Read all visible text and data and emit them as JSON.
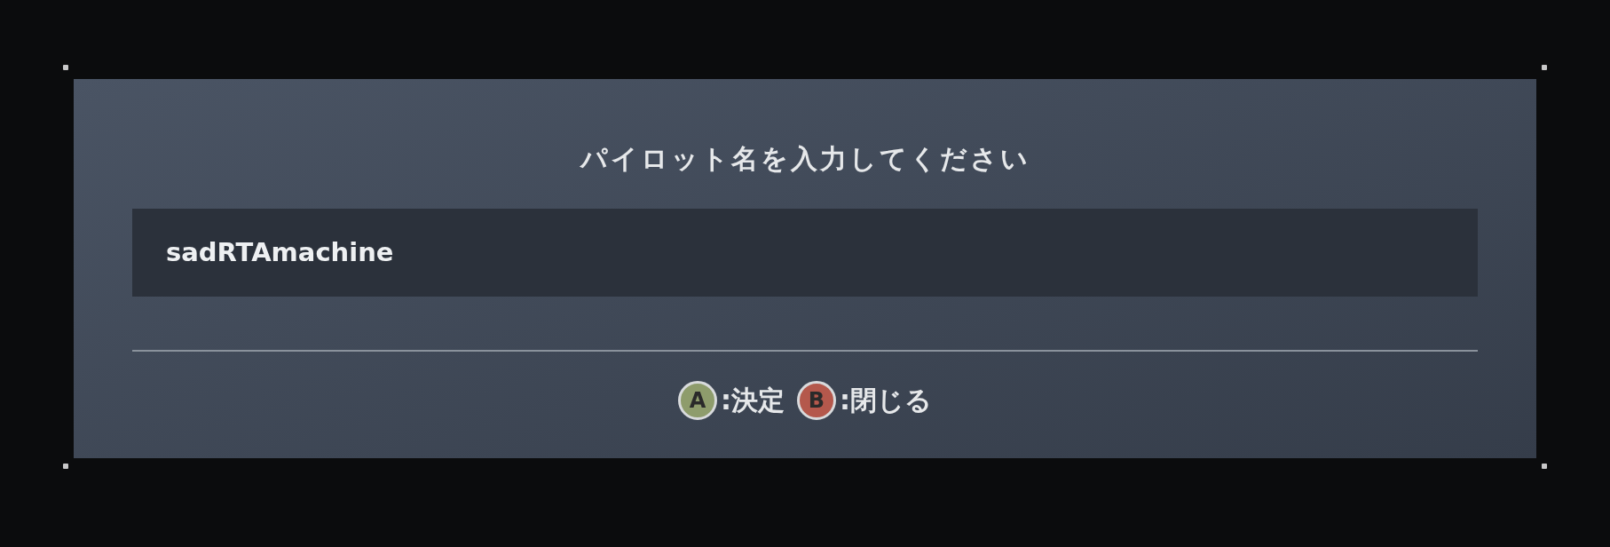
{
  "dialog": {
    "title": "パイロット名を入力してください",
    "name_field": {
      "value": "sadRTAmachine"
    },
    "hints": [
      {
        "key": "A",
        "label": ":決定",
        "color": "#8e9c6c"
      },
      {
        "key": "B",
        "label": ":閉じる",
        "color": "#b4584c"
      }
    ]
  }
}
